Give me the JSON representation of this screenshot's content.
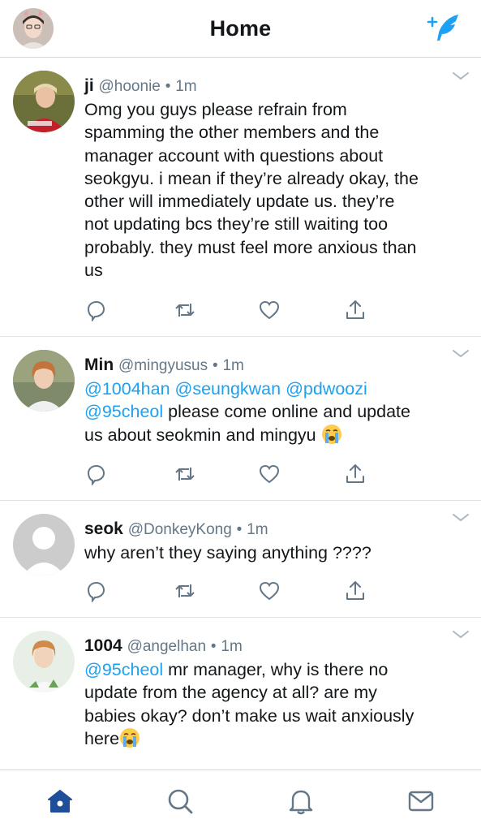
{
  "header": {
    "title": "Home"
  },
  "tweets": [
    {
      "name": "ji",
      "handle": "@hoonie",
      "time": "1m",
      "text_lines": [
        "Omg you guys please refrain from",
        "spamming the other members and the",
        "manager account with questions about",
        "seokgyu. i mean if they’re already okay, the",
        "other will immediately update us. they’re",
        "not updating bcs they’re still waiting too",
        "probably. they must feel more anxious than",
        "us"
      ]
    },
    {
      "name": "Min",
      "handle": "@mingyusus",
      "time": "1m",
      "mentions_line1": "@1004han @seungkwan @pdwoozi",
      "mention_line2": "@95cheol",
      "text_line2": " please come online and update",
      "text_line3": "us about seokmin and mingyu "
    },
    {
      "name": "seok",
      "handle": "@DonkeyKong",
      "time": "1m",
      "text_lines": [
        "why aren’t they saying anything ????"
      ]
    },
    {
      "name": "1004",
      "handle": "@angelhan",
      "time": "1m",
      "mention": "@95cheol",
      "text_line1": " mr manager, why is there no",
      "text_line2": "update from the agency at all? are my",
      "text_line3": "babies okay? don’t make us wait anxiously",
      "text_line4": "here"
    }
  ],
  "colors": {
    "accent": "#1da1f2",
    "tab_active": "#1f4e9a",
    "icon_gray": "#657786",
    "text": "#14171a"
  },
  "tabs": [
    "home-icon",
    "search-icon",
    "notifications-icon",
    "messages-icon"
  ]
}
